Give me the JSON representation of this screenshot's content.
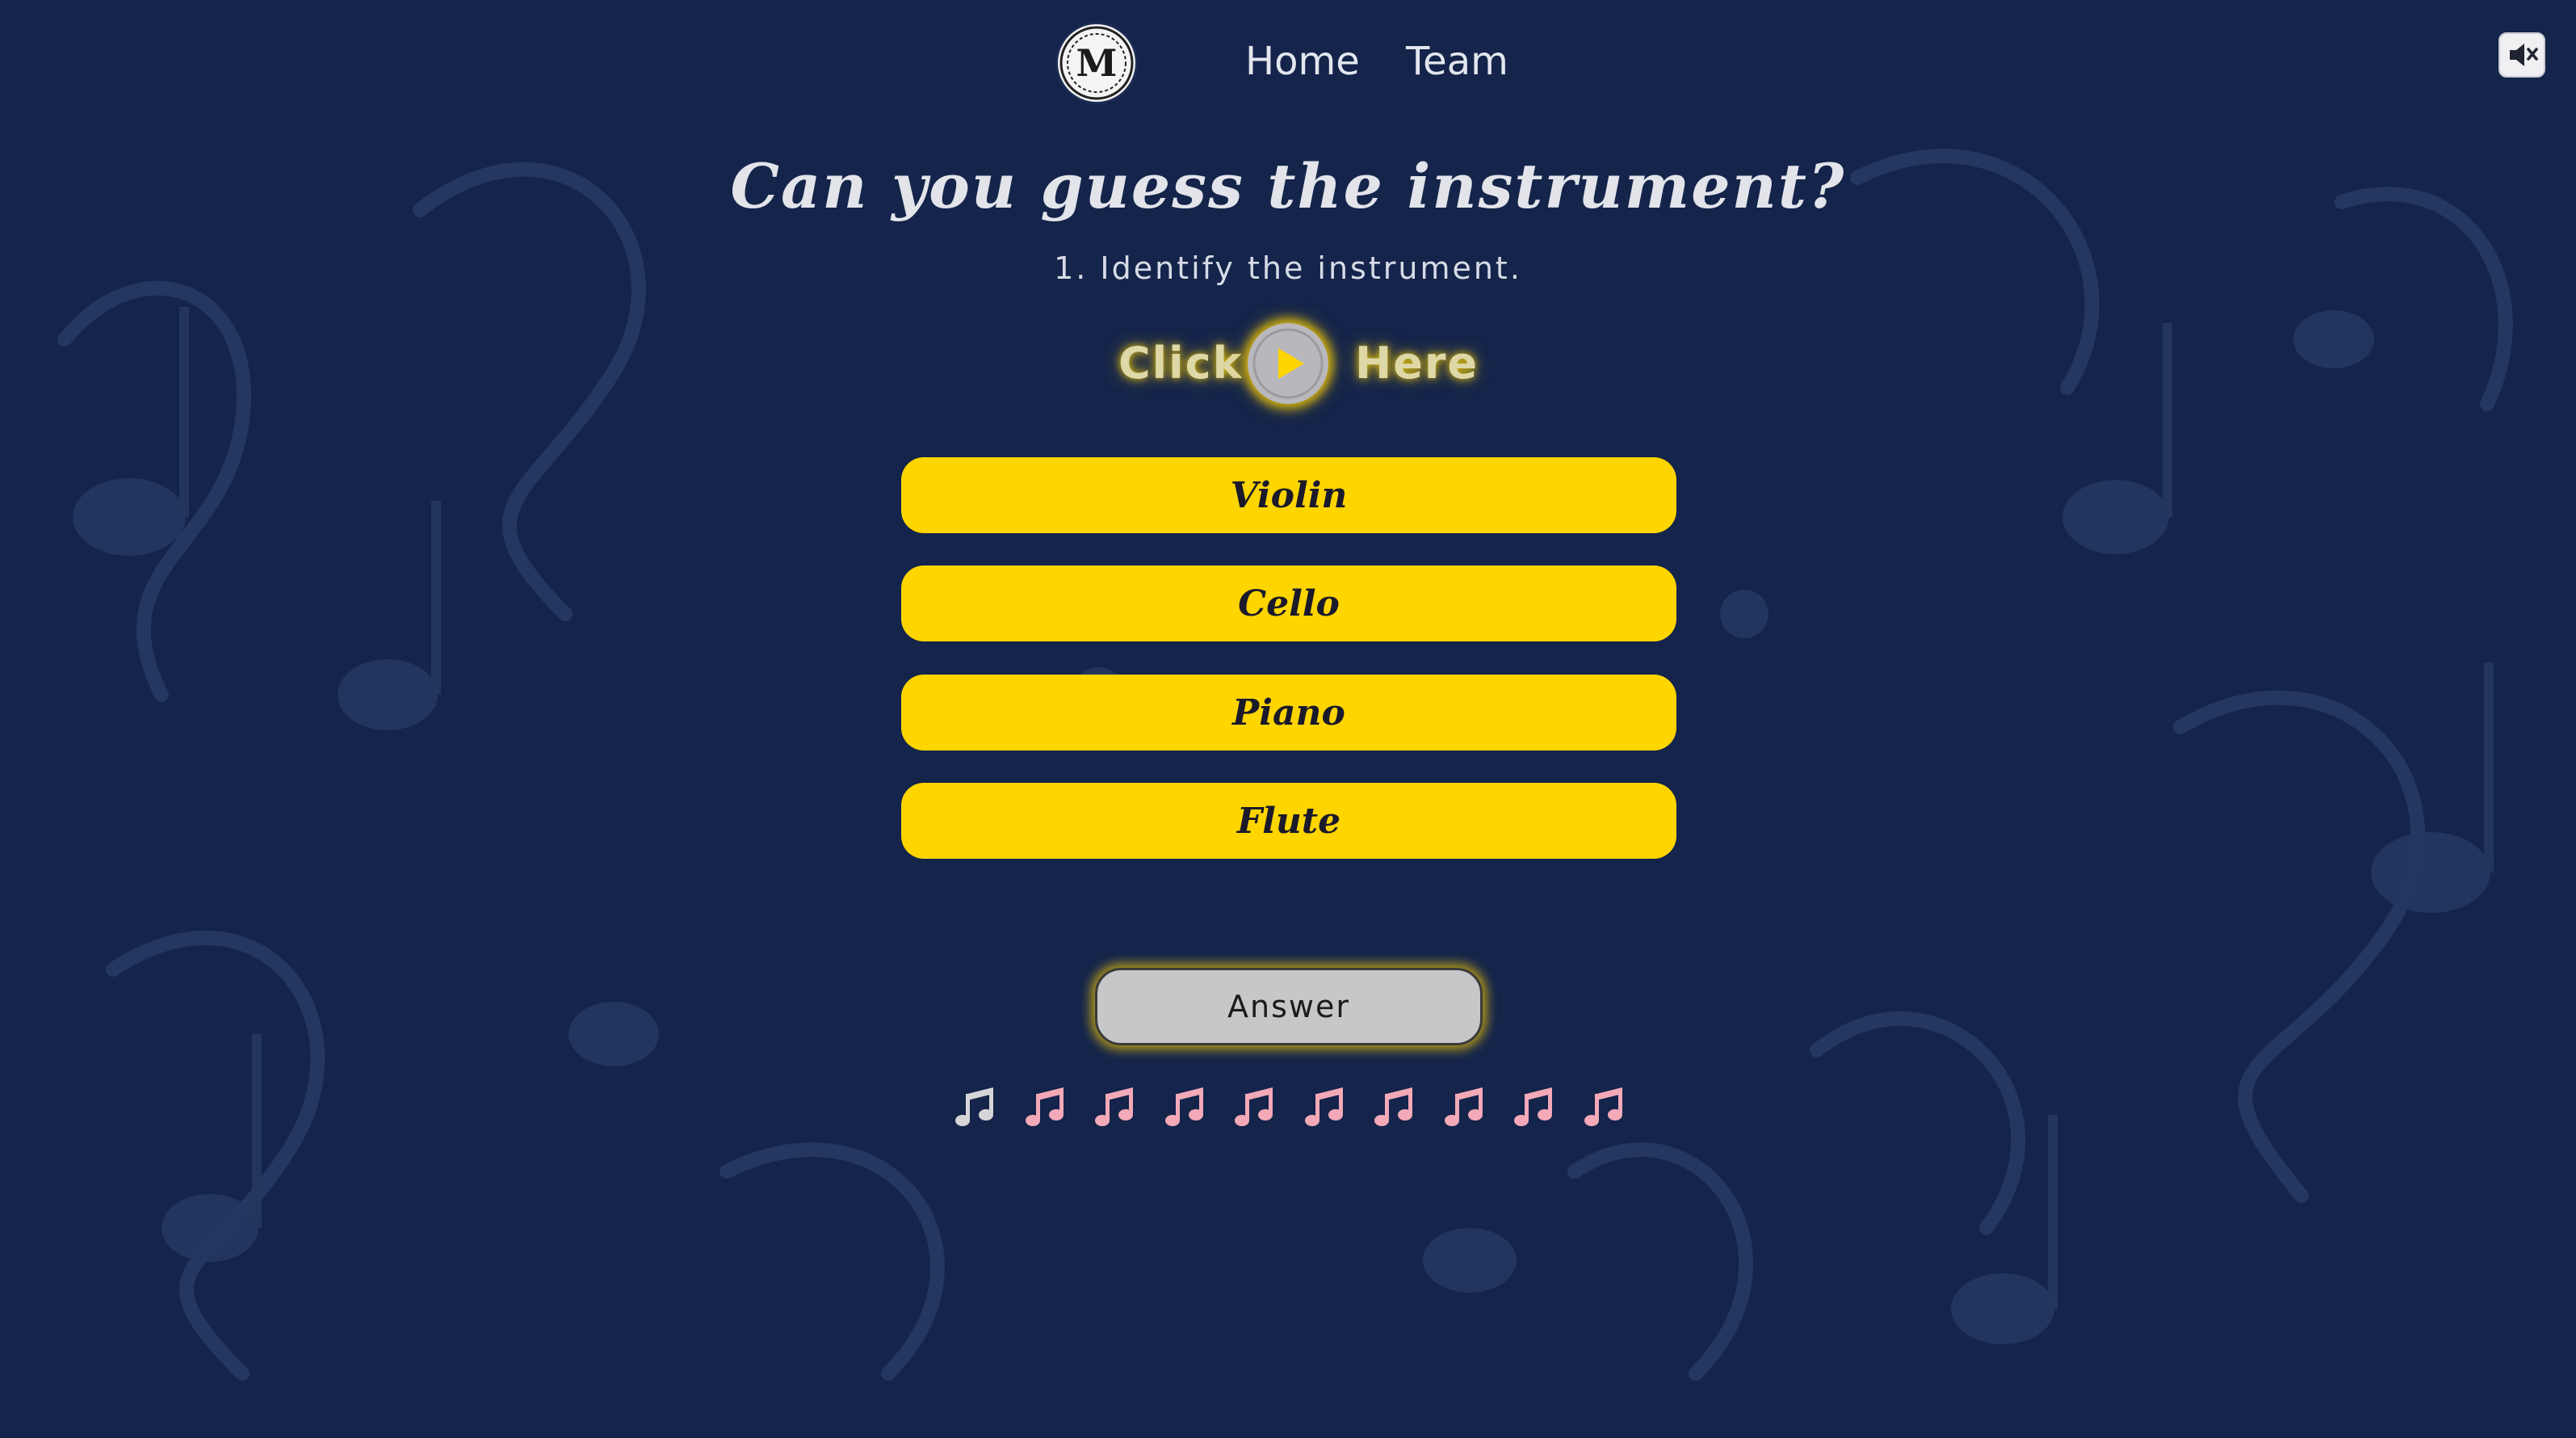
{
  "nav": {
    "logo_letter": "M",
    "home": "Home",
    "team": "Team"
  },
  "sound": {
    "icon": "speaker-muted-icon"
  },
  "quiz": {
    "title": "Can you guess the instrument?",
    "question": "1. Identify the instrument.",
    "click_word": "Click",
    "here_word": "Here",
    "play_icon": "play-icon",
    "options": [
      "Violin",
      "Cello",
      "Piano",
      "Flute"
    ],
    "answer_label": "Answer"
  },
  "progress": {
    "icon": "music-note-icon",
    "total_questions": 10,
    "current_question": 1,
    "states": [
      "current",
      "pending",
      "pending",
      "pending",
      "pending",
      "pending",
      "pending",
      "pending",
      "pending",
      "pending"
    ]
  },
  "colors": {
    "background": "#14244a",
    "option_fill": "#ffd500",
    "glow": "#ffd200",
    "note_current": "#d6d6d8",
    "note_pending": "#f3a9b8"
  }
}
